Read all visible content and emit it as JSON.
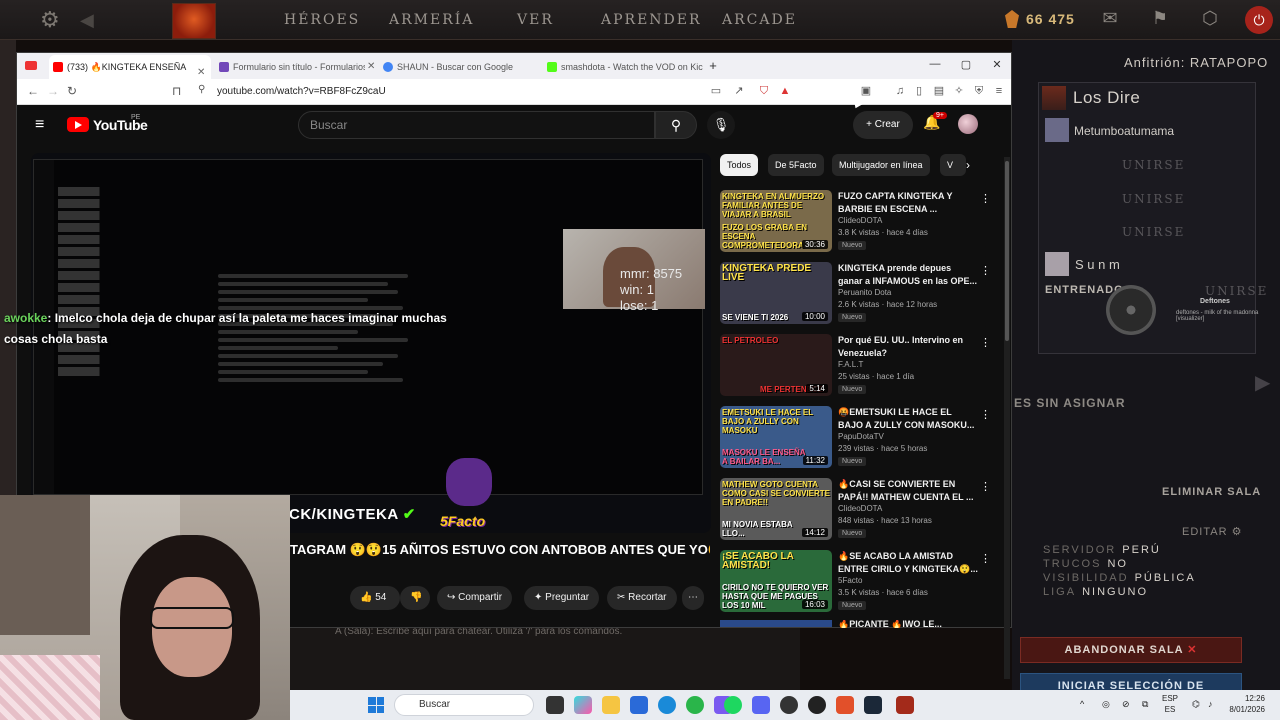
{
  "dota": {
    "nav": [
      "HÉROES",
      "ARMERÍA",
      "VER",
      "APRENDER",
      "ARCADE"
    ],
    "gold": "66 475",
    "host": "Anfitrión: RATAPOPO",
    "team_name": "Los Dire",
    "slot1_name": "Metumboatumama",
    "join_label": "UNIRSE",
    "slot2_name": "S u n m",
    "trainer_label": "ENTRENADO",
    "trainer_join": "UNIRSE",
    "music_title": "Deftones",
    "music_sub": "deftones - milk of the madonna [visualizer]",
    "unassigned": "ES SIN ASIGNAR",
    "delete_room": "ELIMINAR SALA",
    "edit": "EDITAR",
    "settings": [
      {
        "label": "SERVIDOR",
        "value": "PERÚ"
      },
      {
        "label": "TRUCOS",
        "value": "NO"
      },
      {
        "label": "VISIBILIDAD",
        "value": "PÚBLICA"
      },
      {
        "label": "LIGA",
        "value": "NINGUNO"
      }
    ],
    "leave_room": "ABANDONAR SALA",
    "start_selection": "INICIAR SELECCIÓN DE",
    "chat_prefix": "A (Sala):",
    "chat_placeholder": "Escribe aquí para chatear. Utiliza '/' para los comandos."
  },
  "browser": {
    "tabs": [
      {
        "label": "(733) 🔥KINGTEKA ENSEÑA",
        "color": "#ff0000"
      },
      {
        "label": "Formulario sin título - Formularios de",
        "color": "#7248b9"
      },
      {
        "label": "SHAUN - Buscar con Google",
        "color": "#4285f4"
      },
      {
        "label": "smashdota - Watch the VOD on Kick",
        "color": "#53fc18"
      }
    ],
    "url": "youtube.com/watch?v=RBF8FcZ9caU"
  },
  "youtube": {
    "brand": "YouTube",
    "region": "PE",
    "search_placeholder": "Buscar",
    "create_label": "Crear",
    "notif_badge": "9+",
    "video": {
      "mmr": "mmr: 8575",
      "win": "win: 1",
      "lose": "lose: 1",
      "chat_user": "awokke",
      "chat_text": ": Imelco chola deja de chupar así la paleta me haces imaginar muchas",
      "chat_text2": "cosas chola basta",
      "kick_banner": "CK/KINGTEKA",
      "watermark": "5Facto"
    },
    "title": "TAGRAM 😲😲15 AÑITOS ESTUVO CON ANTOBOB ANTES QUE YO😲",
    "likes": "54",
    "share": "Compartir",
    "ask": "Preguntar",
    "clip": "Recortar",
    "chips": [
      "Todos",
      "De 5Facto",
      "Multijugador en línea",
      "V"
    ],
    "recs": [
      {
        "title": "FUZO CAPTA KINGTEKA Y BARBIE EN ESCENA ...",
        "channel": "ClideoDOTA",
        "meta": "3.8 K vistas · hace 4 días",
        "duration": "30:36",
        "badge": "Nuevo",
        "cap": "KINGTEKA EN ALMUERZO FAMILIAR ANTES DE VIAJAR A BRASIL",
        "cap2": "FUZO LOS GRABA EN ESCENA COMPROMETEDORA",
        "bg": "#7a6a4a"
      },
      {
        "title": "KINGTEKA prende depues ganar a INFAMOUS en las OPE...",
        "channel": "Peruanito Dota",
        "meta": "2.6 K vistas · hace 12 horas",
        "duration": "10:00",
        "badge": "Nuevo",
        "cap": "KINGTEKA PREDE LIVE",
        "cap2": "SE VIENE TI 2026",
        "bg": "#3a3a4a"
      },
      {
        "title": "Por qué EU. UU.. Intervino en Venezuela?",
        "channel": "F.A.L.T",
        "meta": "25 vistas · hace 1 día",
        "duration": "5:14",
        "badge": "Nuevo",
        "cap": "EL PETROLEO",
        "cap2": "ME PERTENECE",
        "bg": "#3a1a1a"
      },
      {
        "title": "🤬EMETSUKI LE HACE EL BAJO A ZULLY CON MASOKU...",
        "channel": "PapuDotaTV",
        "meta": "239 vistas · hace 5 horas",
        "duration": "11:32",
        "badge": "Nuevo",
        "cap": "EMETSUKI LE HACE EL BAJO A ZULLY CON MASOKU",
        "cap2": "MASOKU LE ENSEÑA A BAILAR BA...",
        "bg": "#3a5a8a"
      },
      {
        "title": "🔥CASI SE CONVIERTE EN PAPÁ!! MATHEW CUENTA EL ...",
        "channel": "ClideoDOTA",
        "meta": "848 vistas · hace 13 horas",
        "duration": "14:12",
        "badge": "Nuevo",
        "cap": "MATHEW GOTO CUENTA COMO CASI SE CONVIERTE EN PADRE!!",
        "cap2": "MI NOVIA ESTABA LLO...",
        "bg": "#5a5a5a"
      },
      {
        "title": "🔥SE ACABO LA AMISTAD ENTRE CIRILO Y KINGTEKA😲...",
        "channel": "5Facto",
        "meta": "3.5 K vistas · hace 6 días",
        "duration": "16:03",
        "badge": "Nuevo",
        "cap": "¡SE ACABO LA AMISTAD!",
        "cap2": "CIRILO NO TE QUIERO VER HASTA QUE ME PAGUES LOS 10 MIL",
        "bg": "#2a6a3a"
      }
    ],
    "rec_partial": "🔥PICANTE 🔥IWO LE..."
  },
  "taskbar": {
    "search": "Buscar",
    "lang1": "ESP",
    "lang2": "ES",
    "time": "12:26",
    "date": "8/01/2026"
  }
}
